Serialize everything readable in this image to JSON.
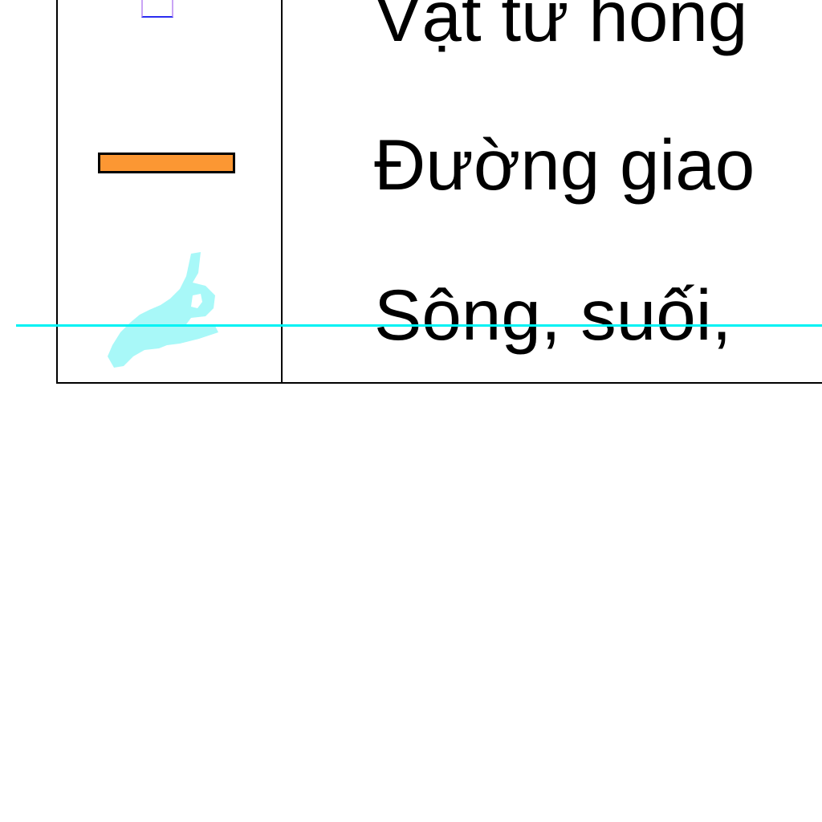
{
  "legend": {
    "items": [
      {
        "symbol": "box-icon",
        "label": "Vật tư hỏng"
      },
      {
        "symbol": "road-line-icon",
        "label": "Đường giao"
      },
      {
        "symbol": "river-icon",
        "label": "Sông, suối,"
      }
    ]
  },
  "colors": {
    "road": "#fc9733",
    "river": "#a8f8f8",
    "guide_line": "#00f2f4",
    "box_border": "#2a2cf0",
    "table_border": "#000000"
  }
}
